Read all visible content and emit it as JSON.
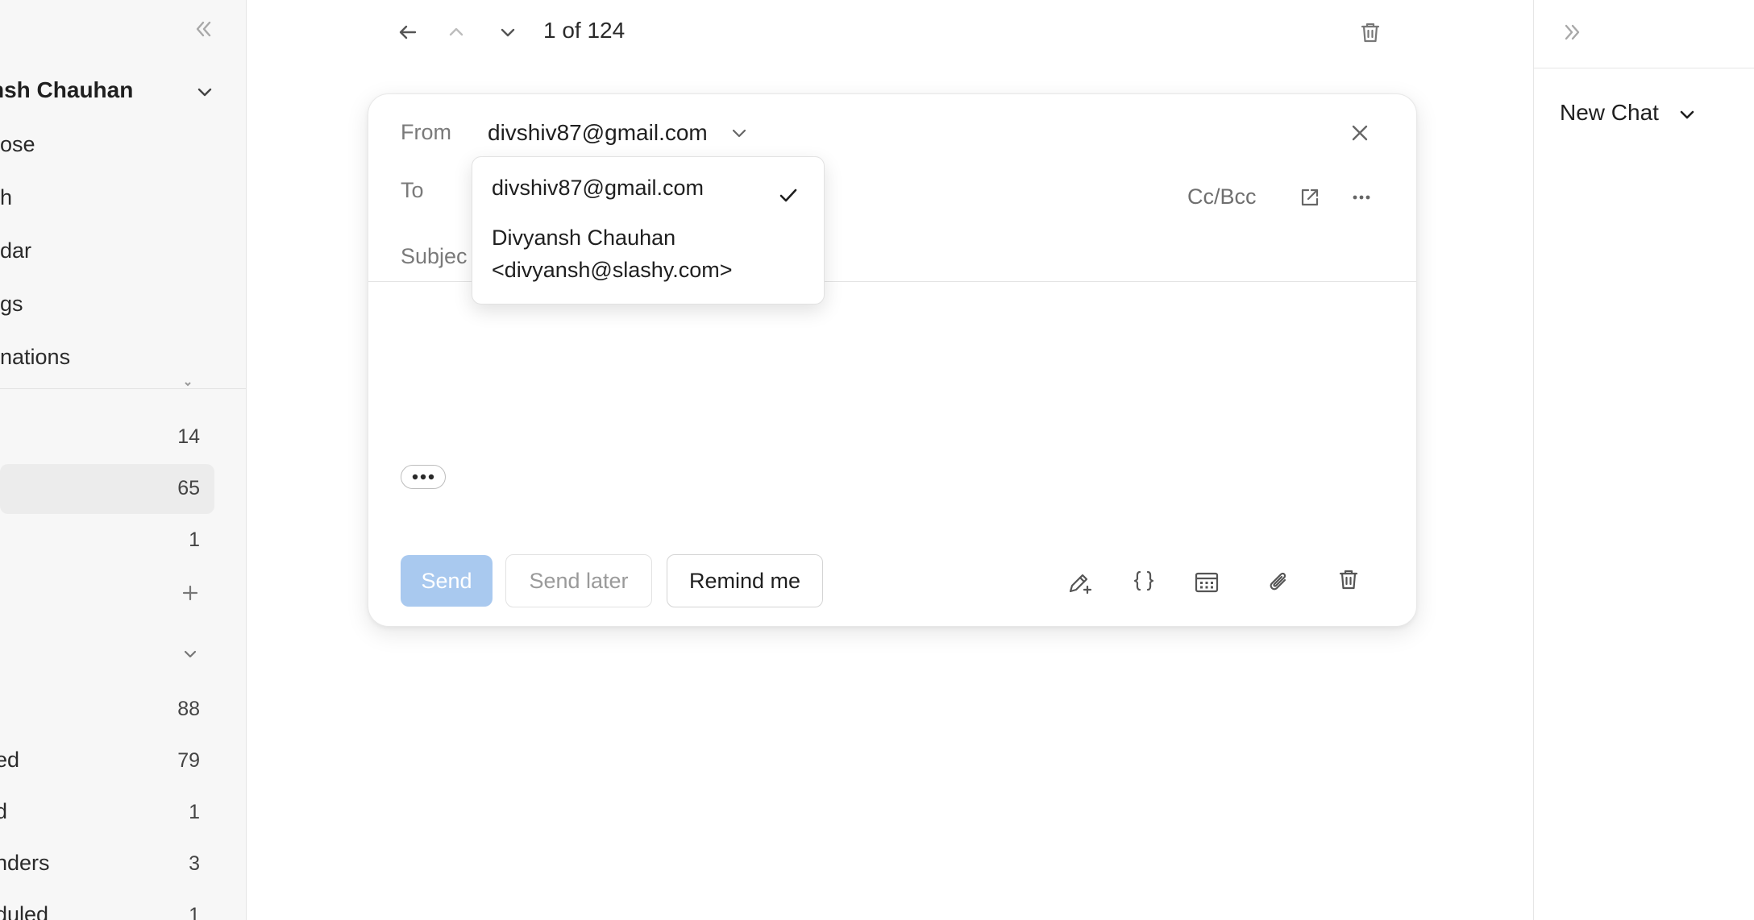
{
  "sidebar": {
    "account_name": "nsh Chauhan",
    "nav_items": [
      {
        "label": "ose"
      },
      {
        "label": "h"
      },
      {
        "label": "dar"
      },
      {
        "label": "gs"
      },
      {
        "label": "nations"
      }
    ],
    "folders": [
      {
        "label": "",
        "count": "14"
      },
      {
        "label": "",
        "count": "65"
      },
      {
        "label": "",
        "count": "1"
      }
    ],
    "labels": [
      {
        "label": "",
        "count": "88"
      },
      {
        "label": "ed",
        "count": "79"
      },
      {
        "label": "d",
        "count": "1"
      },
      {
        "label": "nders",
        "count": "3"
      },
      {
        "label": "duled",
        "count": "1"
      }
    ]
  },
  "topbar": {
    "count_text": "1 of 124"
  },
  "composer": {
    "from_label": "From",
    "from_value": "divshiv87@gmail.com",
    "to_label": "To",
    "subject_label": "Subjec",
    "ccbcc_label": "Cc/Bcc",
    "send_label": "Send",
    "send_later_label": "Send later",
    "remind_label": "Remind me"
  },
  "from_dropdown": {
    "options": [
      {
        "line1": "divshiv87@gmail.com",
        "selected": true
      },
      {
        "line1": "Divyansh Chauhan",
        "line2": "<divyansh@slashy.com>",
        "selected": false
      }
    ]
  },
  "right_panel": {
    "new_chat_label": "New Chat"
  },
  "colors": {
    "send_disabled": "#a9c9ef",
    "sidebar_bg": "#f7f7f7",
    "active_row": "#ececec"
  }
}
